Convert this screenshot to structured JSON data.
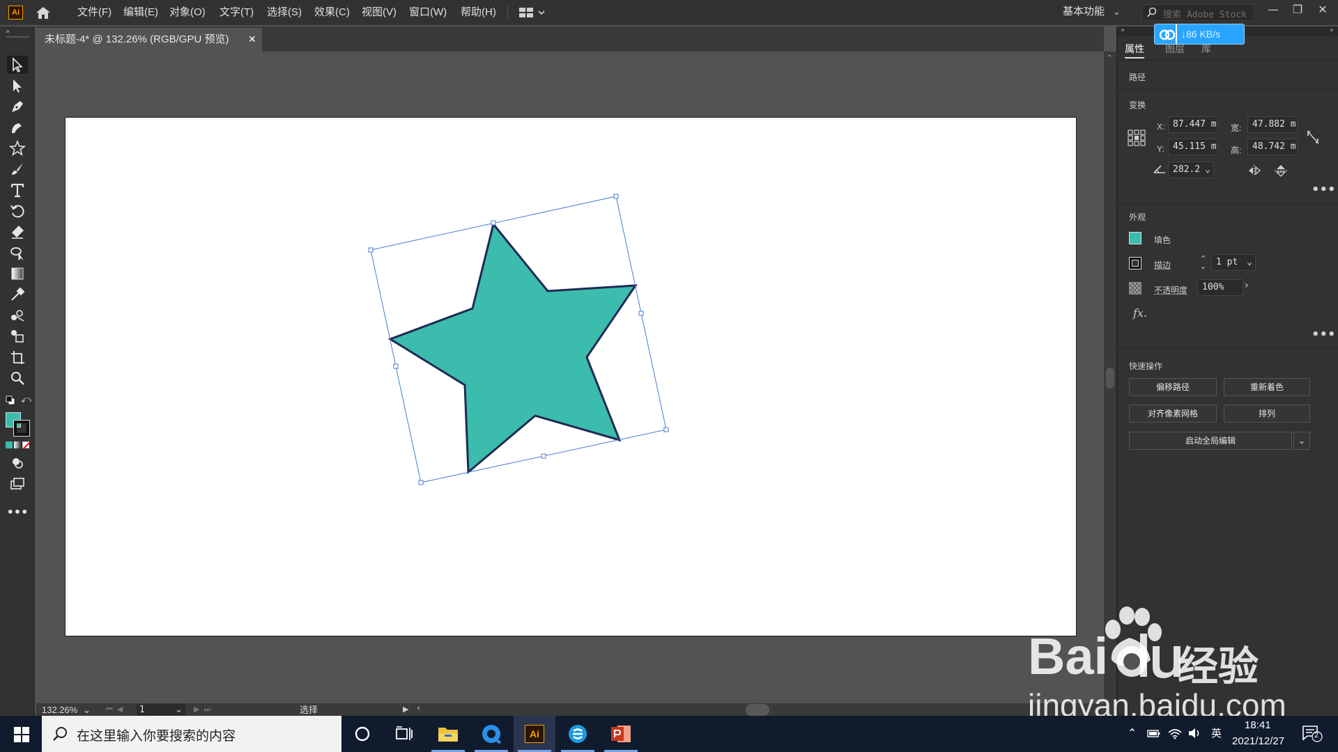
{
  "app": {
    "logo": "Ai",
    "menu": [
      "文件(F)",
      "编辑(E)",
      "对象(O)",
      "文字(T)",
      "选择(S)",
      "效果(C)",
      "视图(V)",
      "窗口(W)",
      "帮助(H)"
    ],
    "workspace": "基本功能",
    "stock_search_placeholder": "搜索 Adobe Stock",
    "window_controls": [
      "—",
      "❐",
      "✕"
    ]
  },
  "document": {
    "tab_title": "未标题-4* @ 132.26% (RGB/GPU 预览)",
    "tab_close": "✕"
  },
  "status": {
    "zoom": "132.26%",
    "page": "1",
    "mode": "选择"
  },
  "net_badge": {
    "speed": "↓86 KB/s"
  },
  "properties": {
    "tabs": [
      "属性",
      "图层",
      "库"
    ],
    "selection_type": "路径",
    "transform": {
      "title": "变换",
      "x_label": "X:",
      "x": "87.447 m",
      "y_label": "Y:",
      "y": "45.115 m",
      "w_label": "宽:",
      "w": "47.882 m",
      "h_label": "高:",
      "h": "48.742 m",
      "angle": "282.2"
    },
    "appearance": {
      "title": "外观",
      "fill_label": "填色",
      "fill_color": "#3bbcac",
      "stroke_label": "描边",
      "stroke_weight": "1 pt",
      "opacity_label": "不透明度",
      "opacity": "100%",
      "fx": "fx."
    },
    "quick_actions": {
      "title": "快速操作",
      "offset_path": "偏移路径",
      "recolor": "重新着色",
      "align_pixel_grid": "对齐像素网格",
      "arrange": "排列",
      "global_edit": "启动全局编辑"
    }
  },
  "artwork": {
    "star_fill": "#3bbcac",
    "star_stroke": "#1e2a55",
    "selection_color": "#4a7bd0"
  },
  "taskbar": {
    "search_placeholder": "在这里输入你要搜索的内容",
    "time": "18:41",
    "date": "2021/12/27",
    "ime": "英",
    "notifications": "2"
  },
  "watermark": {
    "brand": "Bai",
    "brand_suffix": "经验",
    "url": "jingyan.baidu.com"
  }
}
